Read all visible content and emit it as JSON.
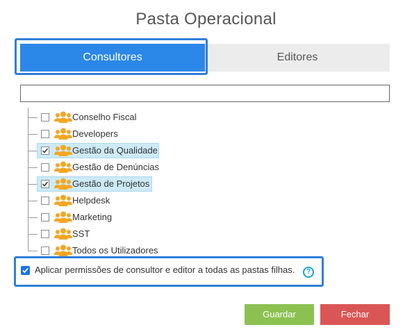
{
  "dialog": {
    "title": "Pasta Operacional"
  },
  "tabs": [
    {
      "label": "Consultores",
      "active": true
    },
    {
      "label": "Editores",
      "active": false
    }
  ],
  "search": {
    "value": "",
    "placeholder": ""
  },
  "tree": {
    "icon": "user-group-icon",
    "items": [
      {
        "label": "Conselho Fiscal",
        "checked": false
      },
      {
        "label": "Developers",
        "checked": false
      },
      {
        "label": "Gestão da Qualidade",
        "checked": true
      },
      {
        "label": "Gestão de Denúncias",
        "checked": false
      },
      {
        "label": "Gestão de Projetos",
        "checked": true
      },
      {
        "label": "Helpdesk",
        "checked": false
      },
      {
        "label": "Marketing",
        "checked": false
      },
      {
        "label": "SST",
        "checked": false
      },
      {
        "label": "Todos os Utilizadores",
        "checked": false
      }
    ]
  },
  "apply_children": {
    "label": "Aplicar permissões de consultor e editor a todas as pastas filhas.",
    "checked": true,
    "help_icon": "question-icon"
  },
  "buttons": {
    "save": "Guardar",
    "close": "Fechar"
  },
  "colors": {
    "tab_active": "#2b87e8",
    "highlight": "#2f7fd9",
    "save": "#8cc152",
    "close": "#da5656",
    "group_icon": "#f5a623",
    "selection": "#cdeaf7"
  }
}
